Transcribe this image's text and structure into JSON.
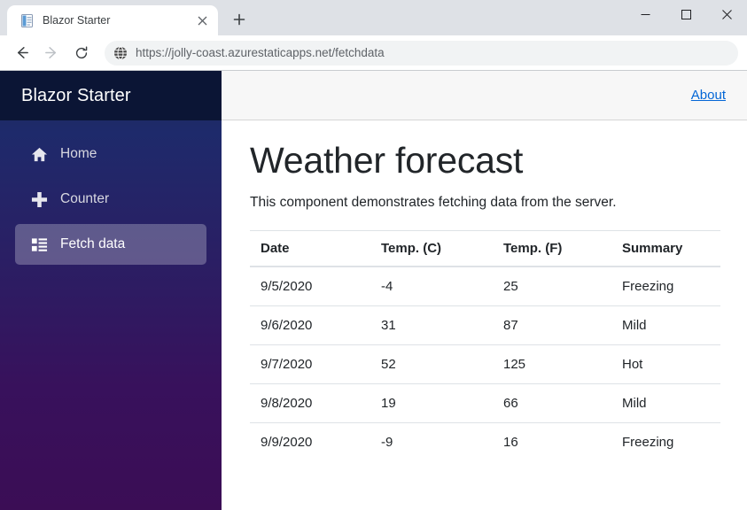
{
  "browser": {
    "tab": {
      "title": "Blazor Starter",
      "favicon_icon": "document-page-icon",
      "close_icon": "close-icon"
    },
    "new_tab_icon": "plus-icon",
    "window_controls": {
      "minimize_icon": "minimize-icon",
      "maximize_icon": "maximize-icon",
      "close_icon": "close-icon"
    },
    "toolbar": {
      "back_icon": "back-arrow-icon",
      "forward_icon": "forward-arrow-icon",
      "reload_icon": "reload-icon",
      "site_icon": "globe-icon",
      "url": "https://jolly-coast.azurestaticapps.net/fetchdata"
    }
  },
  "sidebar": {
    "brand": "Blazor Starter",
    "items": [
      {
        "label": "Home",
        "icon": "home-icon",
        "active": false
      },
      {
        "label": "Counter",
        "icon": "plus-icon",
        "active": false
      },
      {
        "label": "Fetch data",
        "icon": "list-icon",
        "active": true
      }
    ]
  },
  "topbar": {
    "about_label": "About"
  },
  "main": {
    "title": "Weather forecast",
    "subtitle": "This component demonstrates fetching data from the server.",
    "table": {
      "columns": [
        "Date",
        "Temp. (C)",
        "Temp. (F)",
        "Summary"
      ],
      "rows": [
        [
          "9/5/2020",
          "-4",
          "25",
          "Freezing"
        ],
        [
          "9/6/2020",
          "31",
          "87",
          "Mild"
        ],
        [
          "9/7/2020",
          "52",
          "125",
          "Hot"
        ],
        [
          "9/8/2020",
          "19",
          "66",
          "Mild"
        ],
        [
          "9/9/2020",
          "-9",
          "16",
          "Freezing"
        ]
      ]
    }
  },
  "colors": {
    "brand_dark": "#0b1535",
    "sidebar_top": "#1b2a57",
    "sidebar_bottom": "#3b0d55",
    "link": "#0366d6",
    "topbar_bg": "#f7f7f7"
  }
}
